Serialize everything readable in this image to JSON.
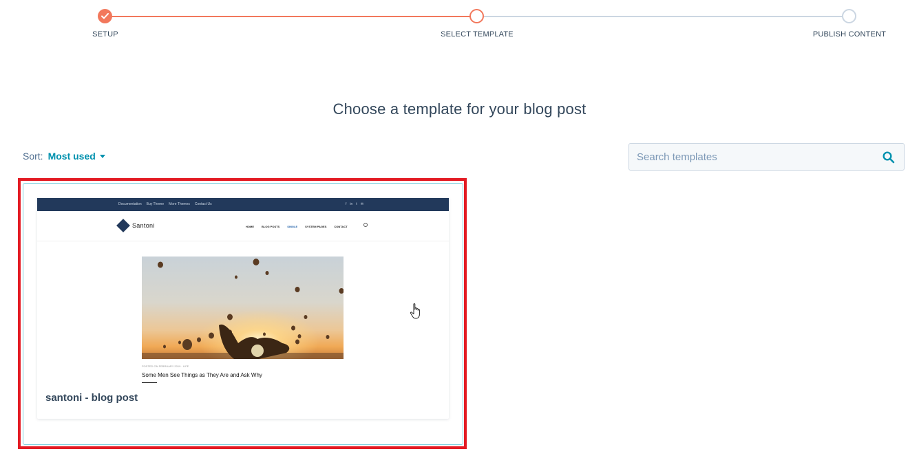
{
  "stepper": {
    "steps": [
      {
        "label": "SETUP",
        "state": "complete"
      },
      {
        "label": "SELECT TEMPLATE",
        "state": "current"
      },
      {
        "label": "PUBLISH CONTENT",
        "state": "upcoming"
      }
    ],
    "colors": {
      "complete": "#f2785c",
      "upcoming": "#cbd6e2"
    }
  },
  "page": {
    "title": "Choose a template for your blog post"
  },
  "sort": {
    "label": "Sort:",
    "value": "Most used"
  },
  "search": {
    "placeholder": "Search templates",
    "value": "",
    "icon": "search-icon"
  },
  "templates": [
    {
      "name": "santoni - blog post",
      "selected": true,
      "preview": {
        "top_links": [
          "Documentation",
          "Buy Theme",
          "More Themes",
          "Contact Us"
        ],
        "brand": "Santoni",
        "nav": [
          "HOME",
          "BLOG POSTS",
          "SINGLE",
          "SYSTEM PAGES",
          "CONTACT"
        ],
        "post_meta": "POSTED ON FEBRUARY 2019 · LIFE",
        "post_title": "Some Men See Things as They Are and Ask Why"
      }
    }
  ],
  "colors": {
    "accent": "#f2785c",
    "link": "#0091ae",
    "text": "#33475b",
    "highlight_border": "#e31b23"
  }
}
